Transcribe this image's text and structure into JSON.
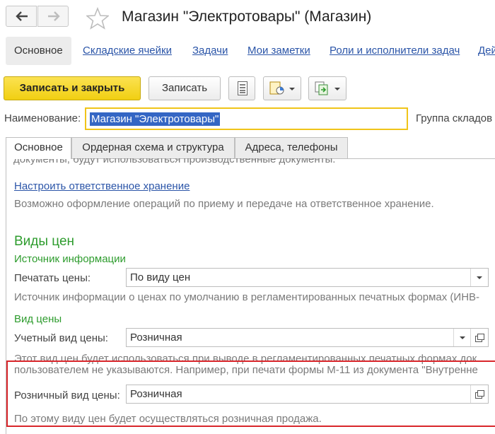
{
  "header": {
    "title": "Магазин \"Электротовары\" (Магазин)"
  },
  "topnav": {
    "items": [
      {
        "label": "Основное"
      },
      {
        "label": "Складские ячейки"
      },
      {
        "label": "Задачи"
      },
      {
        "label": "Мои заметки"
      },
      {
        "label": "Роли и исполнители задач"
      },
      {
        "label": "Дей"
      }
    ]
  },
  "toolbar": {
    "save_close_label": "Записать и закрыть",
    "save_label": "Записать"
  },
  "form": {
    "name_label": "Наименование:",
    "name_value": "Магазин \"Электротовары\"",
    "group_label": "Группа складов"
  },
  "tabs": [
    {
      "label": "Основное"
    },
    {
      "label": "Ордерная схема и структура"
    },
    {
      "label": "Адреса, телефоны"
    }
  ],
  "panel": {
    "cut_text": "документы, будут использоваться производственные документы.",
    "custody_link": "Настроить ответственное хранение",
    "custody_hint": "Возможно оформление операций по приему и передаче на ответственное хранение.",
    "price_types_heading": "Виды цен",
    "info_source_heading": "Источник информации",
    "print_prices_label": "Печатать цены:",
    "print_prices_value": "По виду цен",
    "print_prices_hint": "Источник информации о ценах по умолчанию в регламентированных печатных формах (ИНВ-",
    "price_type_heading": "Вид цены",
    "account_price_label": "Учетный вид цены:",
    "account_price_value": "Розничная",
    "account_hint_1": "Этот вид цен будет использоваться при выводе в регламентированных печатных формах док",
    "account_hint_2": "пользователем не указываются. Например, при печати формы М-11 из документа \"Внутренне",
    "retail_price_label": "Розничный вид цены:",
    "retail_price_value": "Розничная",
    "retail_hint": "По этому виду цен будет осуществляться розничная продажа."
  },
  "colors": {
    "accent_yellow": "#f1cf12",
    "link_blue": "#2b55a8",
    "section_green": "#2e9c2e",
    "highlight_red": "#d9262b",
    "selection_blue": "#3466c4"
  }
}
